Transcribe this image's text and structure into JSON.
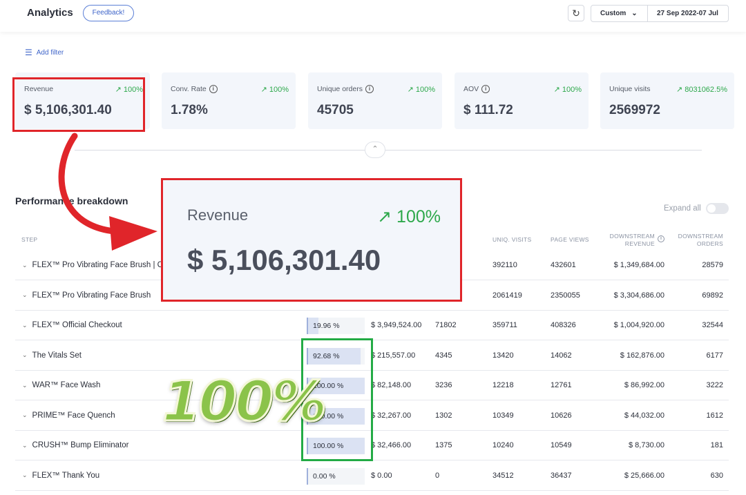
{
  "header": {
    "title": "Analytics",
    "feedback_label": "Feedback!",
    "range_select": "Custom",
    "date_range": "27 Sep 2022-07 Jul"
  },
  "filter": {
    "add_label": "Add filter"
  },
  "kpis": [
    {
      "label": "Revenue",
      "change": "100%",
      "value": "$ 5,106,301.40"
    },
    {
      "label": "Conv. Rate",
      "change": "100%",
      "value": "1.78%"
    },
    {
      "label": "Unique orders",
      "change": "100%",
      "value": "45705"
    },
    {
      "label": "AOV",
      "change": "100%",
      "value": "$ 111.72"
    },
    {
      "label": "Unique visits",
      "change": "8031062.5%",
      "value": "2569972"
    }
  ],
  "zoom": {
    "label": "Revenue",
    "change": "100%",
    "value": "$ 5,106,301.40"
  },
  "overlay_text": "100%",
  "performance": {
    "title": "Performance breakdown",
    "expand_label": "Expand all",
    "columns": {
      "step": "STEP",
      "uniq_visits": "UNIQ. VISITS",
      "page_views": "PAGE VIEWS",
      "downstream_revenue_1": "DOWNSTREAM",
      "downstream_revenue_2": "REVENUE",
      "downstream_orders_1": "DOWNSTREAM",
      "downstream_orders_2": "ORDERS"
    },
    "rows": [
      {
        "name": "FLEX™ Pro Vibrating Face Brush | C",
        "pct": "",
        "pct_value": null,
        "revenue": "",
        "orders": "",
        "uniq_visits": "392110",
        "page_views": "432601",
        "ds_revenue": "$ 1,349,684.00",
        "ds_orders": "28579"
      },
      {
        "name": "FLEX™ Pro Vibrating Face Brush",
        "pct": "",
        "pct_value": null,
        "revenue": "",
        "orders": "",
        "uniq_visits": "2061419",
        "page_views": "2350055",
        "ds_revenue": "$ 3,304,686.00",
        "ds_orders": "69892"
      },
      {
        "name": "FLEX™ Official Checkout",
        "pct": "19.96 %",
        "pct_value": 19.96,
        "revenue": "$ 3,949,524.00",
        "orders": "71802",
        "uniq_visits": "359711",
        "page_views": "408326",
        "ds_revenue": "$ 1,004,920.00",
        "ds_orders": "32544"
      },
      {
        "name": "The Vitals Set",
        "pct": "92.68 %",
        "pct_value": 92.68,
        "revenue": "$ 215,557.00",
        "orders": "4345",
        "uniq_visits": "13420",
        "page_views": "14062",
        "ds_revenue": "$ 162,876.00",
        "ds_orders": "6177"
      },
      {
        "name": "WAR™ Face Wash",
        "pct": "100.00 %",
        "pct_value": 100,
        "revenue": "$ 82,148.00",
        "orders": "3236",
        "uniq_visits": "12218",
        "page_views": "12761",
        "ds_revenue": "$ 86,992.00",
        "ds_orders": "3222"
      },
      {
        "name": "PRIME™ Face Quench",
        "pct": "100.00 %",
        "pct_value": 100,
        "revenue": "$ 32,267.00",
        "orders": "1302",
        "uniq_visits": "10349",
        "page_views": "10626",
        "ds_revenue": "$ 44,032.00",
        "ds_orders": "1612"
      },
      {
        "name": "CRUSH™ Bump Eliminator",
        "pct": "100.00 %",
        "pct_value": 100,
        "revenue": "$ 32,466.00",
        "orders": "1375",
        "uniq_visits": "10240",
        "page_views": "10549",
        "ds_revenue": "$ 8,730.00",
        "ds_orders": "181"
      },
      {
        "name": "FLEX™ Thank You",
        "pct": "0.00 %",
        "pct_value": 0,
        "revenue": "$ 0.00",
        "orders": "0",
        "uniq_visits": "34512",
        "page_views": "36437",
        "ds_revenue": "$ 25,666.00",
        "ds_orders": "630"
      }
    ]
  },
  "colors": {
    "accent": "#3e64c9",
    "positive": "#2da84b",
    "highlight_red": "#e0252a",
    "highlight_green": "#23ab45"
  }
}
